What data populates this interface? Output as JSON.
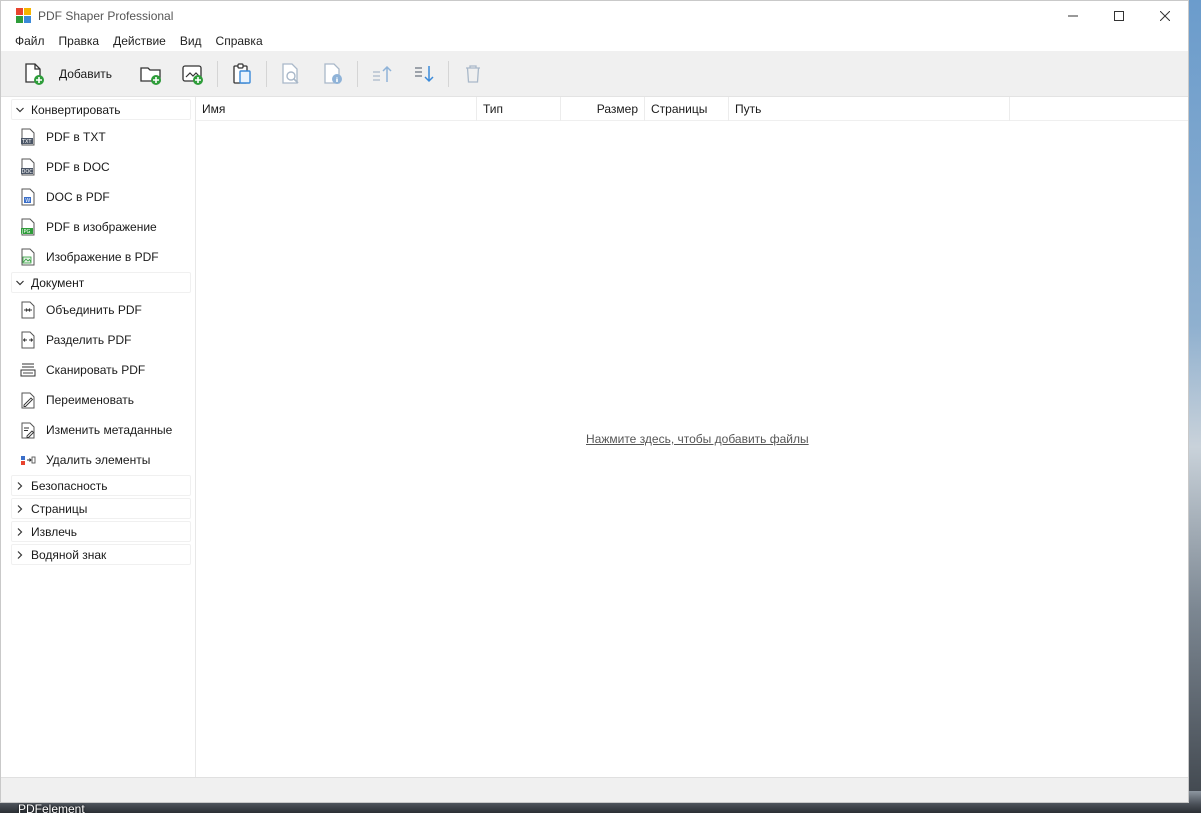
{
  "window": {
    "title": "PDF Shaper Professional"
  },
  "menu": [
    "Файл",
    "Правка",
    "Действие",
    "Вид",
    "Справка"
  ],
  "toolbar": {
    "add_label": "Добавить"
  },
  "sidebar": {
    "groups": [
      {
        "label": "Конвертировать",
        "expanded": true,
        "items": [
          {
            "label": "PDF в TXT",
            "icon": "txt-file-icon"
          },
          {
            "label": "PDF в DOC",
            "icon": "doc-file-icon"
          },
          {
            "label": "DOC в PDF",
            "icon": "word-file-icon"
          },
          {
            "label": "PDF в изображение",
            "icon": "jpg-file-icon"
          },
          {
            "label": "Изображение в PDF",
            "icon": "image-file-icon"
          }
        ]
      },
      {
        "label": "Документ",
        "expanded": true,
        "items": [
          {
            "label": "Объединить PDF",
            "icon": "merge-icon"
          },
          {
            "label": "Разделить PDF",
            "icon": "split-icon"
          },
          {
            "label": "Сканировать PDF",
            "icon": "scanner-icon"
          },
          {
            "label": "Переименовать",
            "icon": "rename-icon"
          },
          {
            "label": "Изменить метаданные",
            "icon": "metadata-icon"
          },
          {
            "label": "Удалить элементы",
            "icon": "remove-elements-icon"
          }
        ]
      },
      {
        "label": "Безопасность",
        "expanded": false,
        "items": []
      },
      {
        "label": "Страницы",
        "expanded": false,
        "items": []
      },
      {
        "label": "Извлечь",
        "expanded": false,
        "items": []
      },
      {
        "label": "Водяной знак",
        "expanded": false,
        "items": []
      }
    ]
  },
  "table": {
    "columns": [
      "Имя",
      "Тип",
      "Размер",
      "Страницы",
      "Путь"
    ],
    "empty_hint": "Нажмите здесь, чтобы добавить файлы"
  },
  "desktop": {
    "taskbar_label": "PDFelement"
  },
  "colors": {
    "accent_green": "#2e9d3a",
    "accent_blue": "#3b8ad9",
    "disabled": "#a9b8c9"
  }
}
